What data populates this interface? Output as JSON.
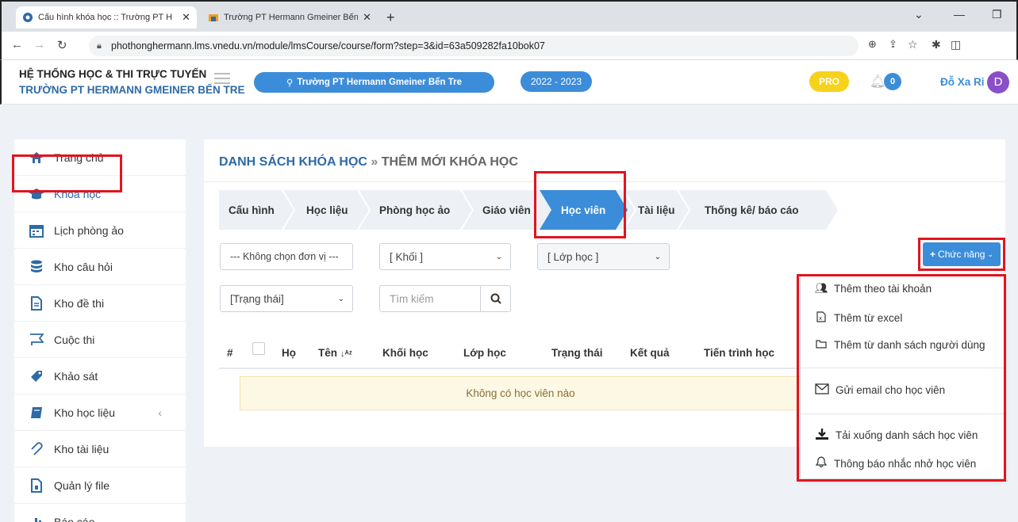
{
  "browser": {
    "tabs": [
      {
        "title": "Cấu hình khóa học :: Trường PT H",
        "close": "✕",
        "active": true
      },
      {
        "title": "Trường PT Hermann Gmeiner Bến",
        "close": "✕",
        "active": false
      }
    ],
    "new_tab": "+",
    "url": "phothonghermann.lms.vnedu.vn/module/lmsCourse/course/form?step=3&id=63a509282fa10bok07",
    "window_controls": [
      "⌄",
      "—",
      "❐"
    ]
  },
  "header": {
    "title_line1": "HỆ THỐNG HỌC & THI TRỰC TUYẾN",
    "title_line2": "TRƯỜNG PT HERMANN GMEINER BẾN TRE",
    "school": "Trường PT Hermann Gmeiner Bến Tre",
    "year": "2022 - 2023",
    "pro": "PRO",
    "notifications": "0",
    "user_name": "Đỗ Xa Ri",
    "avatar": "D"
  },
  "sidebar": {
    "items": [
      {
        "label": "Trang chủ",
        "icon": "home-icon"
      },
      {
        "label": "Khóa học",
        "icon": "graduation-cap-icon"
      },
      {
        "label": "Lịch phòng ảo",
        "icon": "calendar-icon"
      },
      {
        "label": "Kho câu hỏi",
        "icon": "database-icon"
      },
      {
        "label": "Kho đề thi",
        "icon": "document-icon"
      },
      {
        "label": "Cuộc thi",
        "icon": "flag-icon"
      },
      {
        "label": "Khảo sát",
        "icon": "tag-icon"
      },
      {
        "label": "Kho học liệu",
        "icon": "book-icon"
      },
      {
        "label": "Kho tài liệu",
        "icon": "paperclip-icon"
      },
      {
        "label": "Quản lý file",
        "icon": "file-icon"
      },
      {
        "label": "Báo cáo",
        "icon": "bar-chart-icon"
      }
    ],
    "collapse_arrow": "‹"
  },
  "page": {
    "breadcrumb_main": "DANH SÁCH KHÓA HỌC",
    "breadcrumb_sep": " » ",
    "breadcrumb_current": "THÊM MỚI KHÓA HỌC"
  },
  "steps": [
    "Cấu hình",
    "Học liệu",
    "Phòng học ảo",
    "Giáo viên",
    "Học viên",
    "Tài liệu",
    "Thống kê/ báo cáo"
  ],
  "filters": {
    "unit": "--- Không chọn đơn vị ---",
    "grade": "[ Khối ]",
    "class": "[ Lớp học ]",
    "status": "[Trạng thái]",
    "search_placeholder": "Tìm kiếm"
  },
  "function_button": "Chức năng",
  "table": {
    "headers": [
      "#",
      "Họ",
      "Tên",
      "Khối học",
      "Lớp học",
      "Trạng thái",
      "Kết quả",
      "Tiến trình học"
    ],
    "empty": "Không có học viên nào"
  },
  "dropdown": [
    {
      "label": "Thêm theo tài khoản",
      "icon": "users-icon"
    },
    {
      "label": "Thêm từ excel",
      "icon": "excel-file-icon"
    },
    {
      "label": "Thêm từ danh sách người dùng",
      "icon": "folder-icon"
    },
    {
      "label": "Gửi email cho học viên",
      "icon": "envelope-icon"
    },
    {
      "label": "Tải xuống danh sách học viên",
      "icon": "download-icon"
    },
    {
      "label": "Thông báo nhắc nhở học viên",
      "icon": "bell-icon"
    }
  ],
  "colors": {
    "primary": "#3c8dd9",
    "brand_blue": "#2e6aa6",
    "highlight_red": "#e2141f",
    "pro_yellow": "#f7d21a",
    "avatar_purple": "#8a4fc7"
  }
}
